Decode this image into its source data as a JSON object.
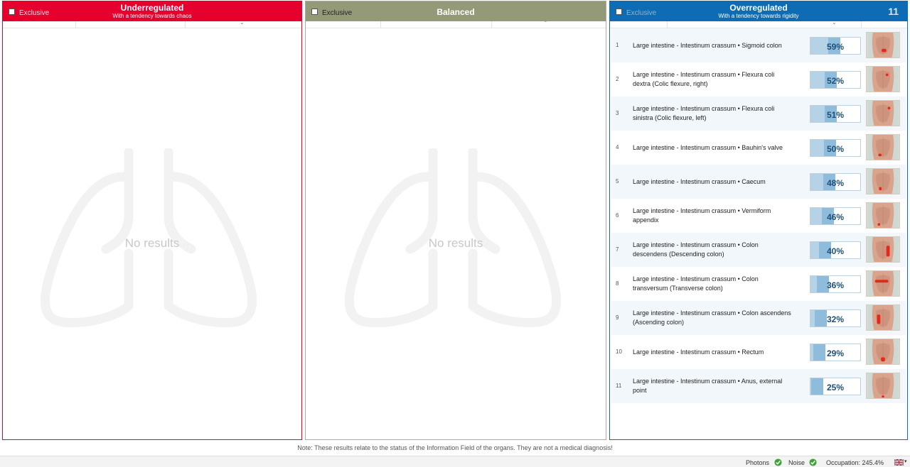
{
  "panels": {
    "underregulated": {
      "exclusive_label": "Exclusive",
      "title": "Underregulated",
      "subtitle": "With a tendency towards chaos",
      "empty_text": "No results",
      "color": "#e6002e"
    },
    "balanced": {
      "exclusive_label": "Exclusive",
      "title": "Balanced",
      "empty_text": "No results",
      "color": "#949a77"
    },
    "overregulated": {
      "exclusive_label": "Exclusive",
      "title": "Overregulated",
      "subtitle": "With a tendency towards rigidity",
      "count": "11",
      "color": "#0d6cb3",
      "rows": [
        {
          "num": "1",
          "line1": "Large intestine - Intestinum crassum • Sigmoid colon",
          "line2": "",
          "pct_label": "59%",
          "pct": 59
        },
        {
          "num": "2",
          "line1": "Large intestine - Intestinum crassum • Flexura coli",
          "line2": "dextra (Colic flexure, right)",
          "pct_label": "52%",
          "pct": 52
        },
        {
          "num": "3",
          "line1": "Large intestine - Intestinum crassum • Flexura coli",
          "line2": "sinistra (Colic flexure, left)",
          "pct_label": "51%",
          "pct": 51
        },
        {
          "num": "4",
          "line1": "Large intestine - Intestinum crassum • Bauhin's valve",
          "line2": "",
          "pct_label": "50%",
          "pct": 50
        },
        {
          "num": "5",
          "line1": "Large intestine - Intestinum crassum • Caecum",
          "line2": "",
          "pct_label": "48%",
          "pct": 48
        },
        {
          "num": "6",
          "line1": "Large intestine - Intestinum crassum • Vermiform",
          "line2": "appendix",
          "pct_label": "46%",
          "pct": 46
        },
        {
          "num": "7",
          "line1": "Large intestine - Intestinum crassum • Colon",
          "line2": "descendens (Descending colon)",
          "pct_label": "40%",
          "pct": 40
        },
        {
          "num": "8",
          "line1": "Large intestine - Intestinum crassum • Colon",
          "line2": "transversum (Transverse colon)",
          "pct_label": "36%",
          "pct": 36
        },
        {
          "num": "9",
          "line1": "Large intestine - Intestinum crassum • Colon ascendens",
          "line2": "(Ascending colon)",
          "pct_label": "32%",
          "pct": 32
        },
        {
          "num": "10",
          "line1": "Large intestine - Intestinum crassum • Rectum",
          "line2": "",
          "pct_label": "29%",
          "pct": 29
        },
        {
          "num": "11",
          "line1": "Large intestine - Intestinum crassum • Anus, external",
          "line2": "point",
          "pct_label": "25%",
          "pct": 25
        }
      ]
    }
  },
  "footer": {
    "note": "Note: These results relate to the status of the Information Field of the organs. They are not a medical diagnosis!"
  },
  "status_bar": {
    "photons_label": "Photons",
    "noise_label": "Noise",
    "occupation": "Occupation: 245.4%",
    "status_icon": "green-check-icon",
    "language_icon": "uk-flag-icon"
  }
}
